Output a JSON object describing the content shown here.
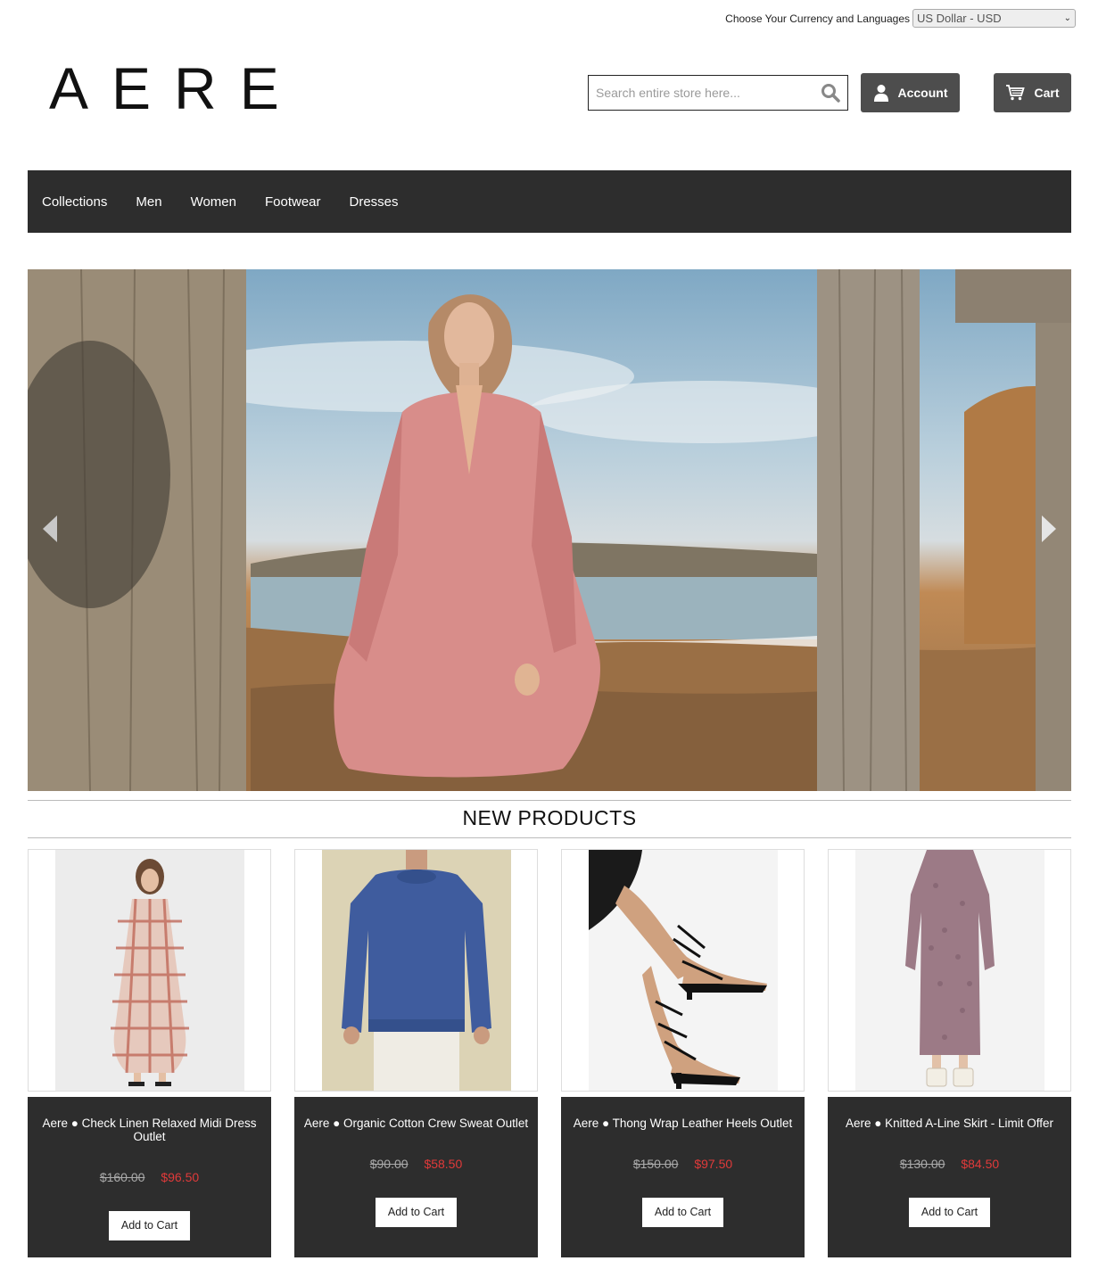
{
  "currency": {
    "label": "Choose Your Currency and Languages",
    "selected": "US Dollar - USD"
  },
  "header": {
    "logo": "AERE",
    "search_placeholder": "Search entire store here...",
    "account_label": "Account",
    "cart_label": "Cart"
  },
  "nav": {
    "items": [
      "Collections",
      "Men",
      "Women",
      "Footwear",
      "Dresses"
    ]
  },
  "section": {
    "title": "NEW PRODUCTS"
  },
  "products": [
    {
      "name": "Aere ● Check Linen Relaxed Midi Dress Outlet",
      "old_price": "$160.00",
      "new_price": "$96.50",
      "button": "Add to Cart"
    },
    {
      "name": "Aere ● Organic Cotton Crew Sweat Outlet",
      "old_price": "$90.00",
      "new_price": "$58.50",
      "button": "Add to Cart"
    },
    {
      "name": "Aere ● Thong Wrap Leather Heels Outlet",
      "old_price": "$150.00",
      "new_price": "$97.50",
      "button": "Add to Cart"
    },
    {
      "name": "Aere ● Knitted A-Line Skirt - Limit Offer",
      "old_price": "$130.00",
      "new_price": "$84.50",
      "button": "Add to Cart"
    }
  ],
  "colors": {
    "nav_bg": "#2d2d2d",
    "button_bg": "#4d4d4d",
    "sale_price": "#e03a3a"
  }
}
